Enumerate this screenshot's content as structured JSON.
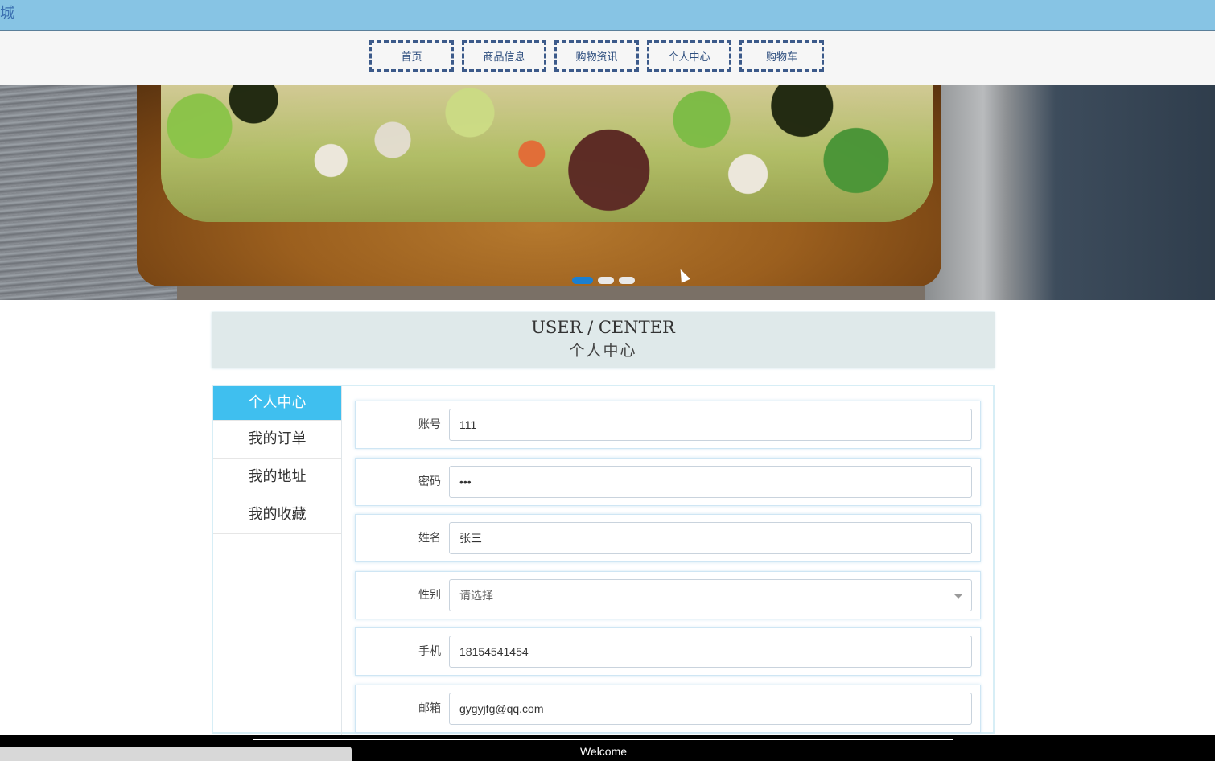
{
  "header": {
    "site_title": "城"
  },
  "nav": {
    "items": [
      {
        "label": "首页"
      },
      {
        "label": "商品信息"
      },
      {
        "label": "购物资讯"
      },
      {
        "label": "个人中心"
      },
      {
        "label": "购物车"
      }
    ]
  },
  "banner": {
    "slide_count": 3,
    "active_slide": 1
  },
  "section_title": {
    "en": "USER / CENTER",
    "cn": "个人中心"
  },
  "sidebar": {
    "items": [
      {
        "label": "个人中心",
        "active": true
      },
      {
        "label": "我的订单",
        "active": false
      },
      {
        "label": "我的地址",
        "active": false
      },
      {
        "label": "我的收藏",
        "active": false
      }
    ]
  },
  "form": {
    "account": {
      "label": "账号",
      "value": "111"
    },
    "password": {
      "label": "密码",
      "value": "•••"
    },
    "name": {
      "label": "姓名",
      "value": "张三"
    },
    "gender": {
      "label": "性别",
      "placeholder": "请选择"
    },
    "phone": {
      "label": "手机",
      "value": "18154541454"
    },
    "email": {
      "label": "邮箱",
      "value": "gygyjfg@qq.com"
    }
  },
  "footer": {
    "text": "Welcome"
  },
  "colors": {
    "header_bg": "#87c4e4",
    "sidebar_active": "#3fbfef",
    "dot_active": "#1a7fd1"
  }
}
